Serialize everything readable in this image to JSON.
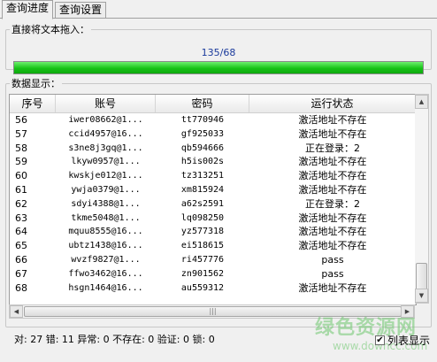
{
  "tabs": [
    {
      "label": "查询进度"
    },
    {
      "label": "查询设置"
    }
  ],
  "drop_group": {
    "title": "直接将文本拖入：",
    "progress_text": "135/68",
    "progress_fill_fraction": 1.0
  },
  "data_group": {
    "title": "数据显示：",
    "columns": [
      "序号",
      "账号",
      "密码",
      "运行状态"
    ],
    "rows": [
      [
        "56",
        "iwer08662@1...",
        "tt770946",
        "激活地址不存在"
      ],
      [
        "57",
        "ccid4957@16...",
        "gf925033",
        "激活地址不存在"
      ],
      [
        "58",
        "s3ne8j3gq@1...",
        "qb594666",
        "正在登录：2"
      ],
      [
        "59",
        "lkyw0957@1...",
        "h5is002s",
        "激活地址不存在"
      ],
      [
        "60",
        "kwskje012@1...",
        "tz313251",
        "激活地址不存在"
      ],
      [
        "61",
        "ywja0379@1...",
        "xm815924",
        "激活地址不存在"
      ],
      [
        "62",
        "sdyi4388@1...",
        "a62s2591",
        "正在登录：2"
      ],
      [
        "63",
        "tkme5048@1...",
        "lq098250",
        "激活地址不存在"
      ],
      [
        "64",
        "mquu8555@16...",
        "yz577318",
        "激活地址不存在"
      ],
      [
        "65",
        "ubtz1438@16...",
        "ei518615",
        "激活地址不存在"
      ],
      [
        "66",
        "wvzf9827@1...",
        "ri457776",
        "pass"
      ],
      [
        "67",
        "ffwo3462@16...",
        "zn901562",
        "pass"
      ],
      [
        "68",
        "hsgn1464@16...",
        "au559312",
        "激活地址不存在"
      ]
    ]
  },
  "status_bar": {
    "text": "对: 27 错: 11 异常: 0 不存在: 0 验证: 0 锁: 0",
    "list_display_label": "列表显示",
    "list_display_checked": true
  },
  "watermark": {
    "line1": "绿色资源网",
    "line2": "www.downcc.com"
  },
  "icons": {
    "scroll_up": "arrow-up-icon",
    "scroll_down": "arrow-down-icon",
    "scroll_left": "arrow-left-icon",
    "scroll_right": "arrow-right-icon"
  }
}
